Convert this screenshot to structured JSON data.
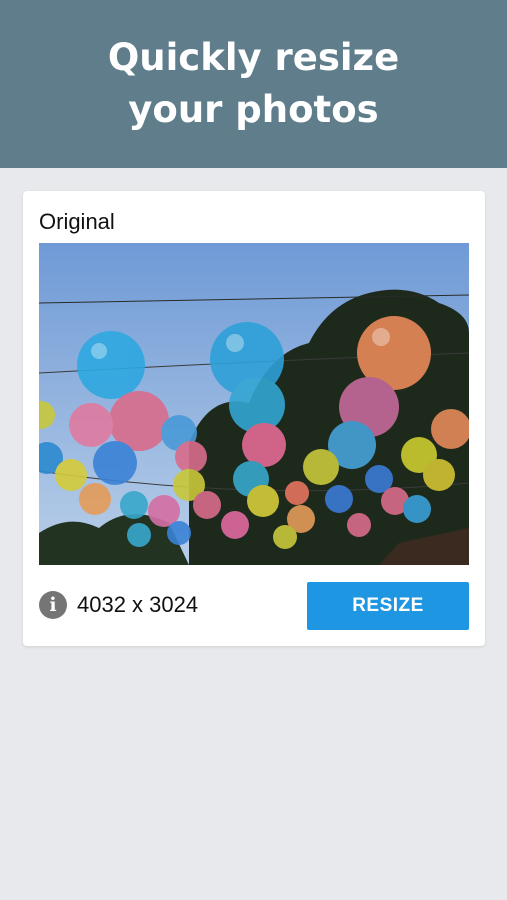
{
  "header": {
    "title": "Quickly resize\nyour photos"
  },
  "card": {
    "label": "Original",
    "image_alt_icon": "info-icon",
    "dimensions": "4032 x 3024",
    "resize_label": "RESIZE"
  },
  "colors": {
    "header_bg": "#607d8b",
    "page_bg": "#e8e9ec",
    "button_bg": "#1e96e2"
  }
}
